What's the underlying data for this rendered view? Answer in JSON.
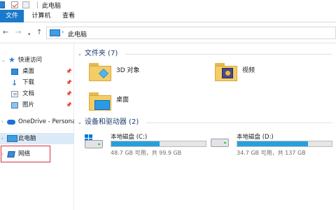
{
  "window": {
    "title": "此电脑"
  },
  "ribbon": {
    "tabs": [
      {
        "label": "文件",
        "active": true
      },
      {
        "label": "计算机",
        "active": false
      },
      {
        "label": "查看",
        "active": false
      }
    ]
  },
  "address": {
    "back_icon": "arrow-left-icon",
    "forward_icon": "arrow-right-icon",
    "recent_icon": "chevron-down-icon",
    "up_icon": "arrow-up-icon",
    "separator": "›",
    "path": "此电脑"
  },
  "sidebar": {
    "items": [
      {
        "label": "快速访问",
        "icon": "star-icon"
      },
      {
        "label": "桌面",
        "icon": "desktop-icon",
        "pinned": true
      },
      {
        "label": "下载",
        "icon": "download-icon",
        "pinned": true
      },
      {
        "label": "文档",
        "icon": "document-icon",
        "pinned": true
      },
      {
        "label": "图片",
        "icon": "picture-icon",
        "pinned": true
      },
      {
        "label": "OneDrive - Personal",
        "icon": "cloud-icon"
      },
      {
        "label": "此电脑",
        "icon": "computer-icon",
        "selected": true
      },
      {
        "label": "网络",
        "icon": "network-icon",
        "highlighted": true
      }
    ],
    "highlight_color": "#d9303a"
  },
  "content": {
    "folders_header": "文件夹 (7)",
    "folders": [
      {
        "label": "3D 对象",
        "icon": "3d-objects-icon"
      },
      {
        "label": "视频",
        "icon": "video-icon"
      },
      {
        "label": "桌面",
        "icon": "desktop-folder-icon"
      }
    ],
    "drives_header": "设备和驱动器 (2)",
    "drives": [
      {
        "name": "本地磁盘 (C:)",
        "info": "48.7 GB 可用，共 99.9 GB",
        "used_fraction": 0.51,
        "icon": "system-drive-icon"
      },
      {
        "name": "本地磁盘 (D:)",
        "info": "34.7 GB 可用，共 137 GB",
        "used_fraction": 0.75,
        "icon": "drive-icon"
      }
    ]
  },
  "colors": {
    "accent": "#1979ca",
    "drive_bar": "#26a0da",
    "folder": "#f3cd66",
    "selection": "#dbe9f8"
  }
}
